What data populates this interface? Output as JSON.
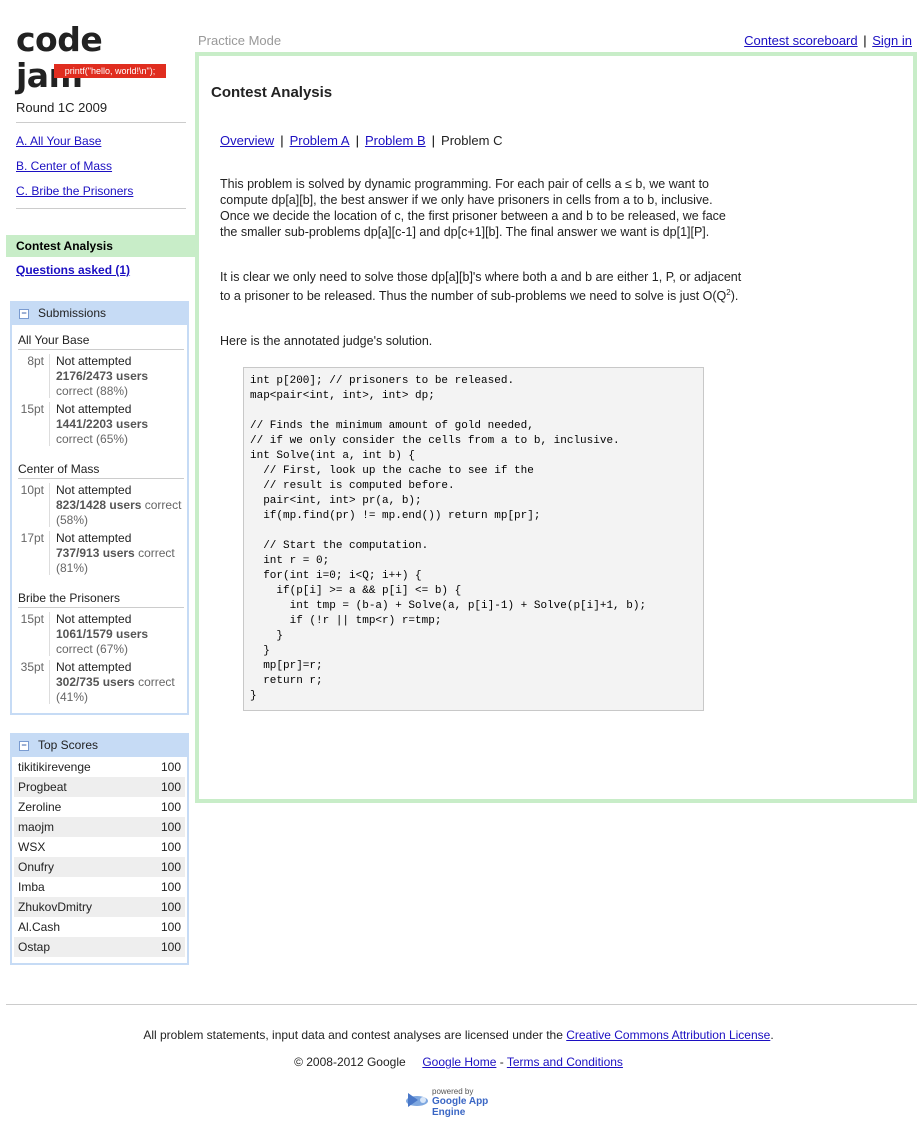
{
  "header": {
    "logo_text": "code jam",
    "logo_tag": "printf(\"hello, world!\\n\");",
    "mode": "Practice Mode",
    "scoreboard_link": "Contest scoreboard",
    "separator": "|",
    "signin_link": "Sign in"
  },
  "sidebar": {
    "round": "Round 1C 2009",
    "problems": [
      {
        "label": "A. All Your Base"
      },
      {
        "label": "B. Center of Mass"
      },
      {
        "label": "C. Bribe the Prisoners"
      }
    ],
    "analysis_label": "Contest Analysis",
    "questions_link": "Questions asked (1)"
  },
  "submissions": {
    "title": "Submissions",
    "toggle": "−",
    "sections": [
      {
        "name": "All Your Base",
        "rows": [
          {
            "pts": "8pt",
            "status": "Not attempted",
            "users": "2176/2473 users",
            "correct": "correct",
            "pct": "(88%)"
          },
          {
            "pts": "15pt",
            "status": "Not attempted",
            "users": "1441/2203 users",
            "correct": "correct",
            "pct": "(65%)"
          }
        ]
      },
      {
        "name": "Center of Mass",
        "rows": [
          {
            "pts": "10pt",
            "status": "Not attempted",
            "users": "823/1428 users",
            "correct": "correct",
            "pct": "(58%)"
          },
          {
            "pts": "17pt",
            "status": "Not attempted",
            "users": "737/913 users",
            "correct": "correct",
            "pct": "(81%)"
          }
        ]
      },
      {
        "name": "Bribe the Prisoners",
        "rows": [
          {
            "pts": "15pt",
            "status": "Not attempted",
            "users": "1061/1579 users",
            "correct": "correct",
            "pct": "(67%)"
          },
          {
            "pts": "35pt",
            "status": "Not attempted",
            "users": "302/735 users",
            "correct": "correct",
            "pct": "(41%)"
          }
        ]
      }
    ]
  },
  "top_scores": {
    "title": "Top Scores",
    "toggle": "−",
    "rows": [
      {
        "name": "tikitikirevenge",
        "score": "100"
      },
      {
        "name": "Progbeat",
        "score": "100"
      },
      {
        "name": "Zeroline",
        "score": "100"
      },
      {
        "name": "maojm",
        "score": "100"
      },
      {
        "name": "WSX",
        "score": "100"
      },
      {
        "name": "Onufry",
        "score": "100"
      },
      {
        "name": "Imba",
        "score": "100"
      },
      {
        "name": "ZhukovDmitry",
        "score": "100"
      },
      {
        "name": "Al.Cash",
        "score": "100"
      },
      {
        "name": "Ostap",
        "score": "100"
      }
    ]
  },
  "main": {
    "title": "Contest Analysis",
    "tabs": {
      "overview": "Overview",
      "problem_a": "Problem A",
      "problem_b": "Problem B",
      "problem_c": "Problem C",
      "sep": "|"
    },
    "para1": "This problem is solved by dynamic programming. For each pair of cells a ≤ b, we want to compute dp[a][b], the best answer if we only have prisoners in cells from a to b, inclusive. Once we decide the location of c, the first prisoner between a and b to be released, we face the smaller sub-problems dp[a][c-1] and dp[c+1][b]. The final answer we want is dp[1][P].",
    "para2_prefix": "It is clear we only need to solve those dp[a][b]'s where both a and b are either 1, P, or adjacent to a prisoner to be released. Thus the number of sub-problems we need to solve is just O(Q",
    "para2_sup": "2",
    "para2_suffix": ").",
    "para3": "Here is the annotated judge's solution.",
    "code": "int p[200]; // prisoners to be released.\nmap<pair<int, int>, int> dp;\n\n// Finds the minimum amount of gold needed,\n// if we only consider the cells from a to b, inclusive.\nint Solve(int a, int b) {\n  // First, look up the cache to see if the\n  // result is computed before.\n  pair<int, int> pr(a, b);\n  if(mp.find(pr) != mp.end()) return mp[pr];\n\n  // Start the computation.\n  int r = 0;\n  for(int i=0; i<Q; i++) {\n    if(p[i] >= a && p[i] <= b) {\n      int tmp = (b-a) + Solve(a, p[i]-1) + Solve(p[i]+1, b);\n      if (!r || tmp<r) r=tmp;\n    }\n  }\n  mp[pr]=r;\n  return r;\n}"
  },
  "footer": {
    "license_text": "All problem statements, input data and contest analyses are licensed under the ",
    "license_link": "Creative Commons Attribution License",
    "license_end": ".",
    "copyright": "© 2008-2012 Google",
    "google_home": "Google Home",
    "dash": "-",
    "terms": "Terms and Conditions",
    "powered_by": "powered by",
    "app_engine": "Google App Engine"
  }
}
